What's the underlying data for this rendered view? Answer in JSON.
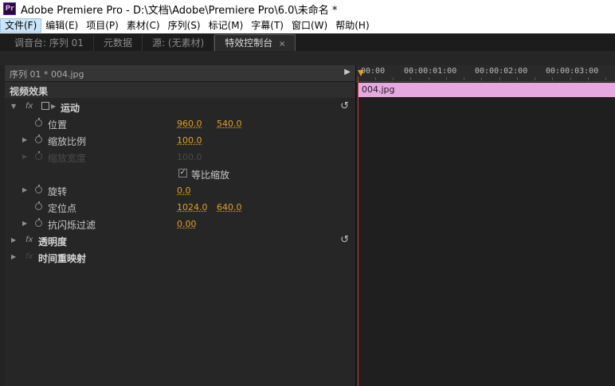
{
  "window": {
    "app_icon": "Pr",
    "title": "Adobe Premiere Pro - D:\\文档\\Adobe\\Premiere Pro\\6.0\\未命名 *"
  },
  "menubar": [
    "文件(F)",
    "编辑(E)",
    "项目(P)",
    "素材(C)",
    "序列(S)",
    "标记(M)",
    "字幕(T)",
    "窗口(W)",
    "帮助(H)"
  ],
  "tabs": [
    {
      "label": "调音台: 序列 01",
      "active": false
    },
    {
      "label": "元数据",
      "active": false
    },
    {
      "label": "源: (无素材)",
      "active": false
    },
    {
      "label": "特效控制台",
      "active": true,
      "close": "×"
    }
  ],
  "effects_panel": {
    "sequence_header": "序列 01 * 004.jpg",
    "section_title": "视频效果",
    "motion": {
      "label": "运动",
      "fx": "fx",
      "properties": {
        "position": {
          "label": "位置",
          "x": "960.0",
          "y": "540.0"
        },
        "scale": {
          "label": "缩放比例",
          "value": "100.0"
        },
        "scale_width": {
          "label": "缩放宽度",
          "value": "100.0"
        },
        "uniform_scale": {
          "label": "等比缩放",
          "checked": true
        },
        "rotation": {
          "label": "旋转",
          "value": "0.0"
        },
        "anchor": {
          "label": "定位点",
          "x": "1024.0",
          "y": "640.0"
        },
        "anti_flicker": {
          "label": "抗闪烁过滤",
          "value": "0.00"
        }
      }
    },
    "opacity": {
      "label": "透明度",
      "fx": "fx"
    },
    "time_remap": {
      "label": "时间重映射",
      "fx": "fx"
    }
  },
  "timeline": {
    "ticks": [
      "00:00",
      "00:00:01:00",
      "00:00:02:00",
      "00:00:03:00"
    ],
    "clip_name": "004.jpg"
  },
  "colors": {
    "value_accent": "#e0a020",
    "clip": "#e6a8e0",
    "playhead": "#d23a3a"
  }
}
